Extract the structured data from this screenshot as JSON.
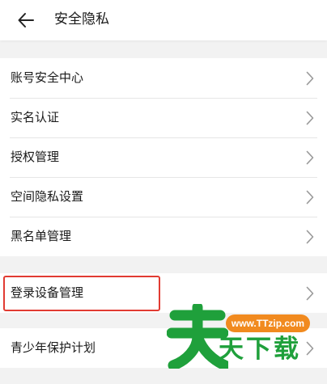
{
  "header": {
    "back_icon": "arrow-left-icon",
    "title": "安全隐私"
  },
  "groups": [
    {
      "items": [
        {
          "label": "账号安全中心"
        },
        {
          "label": "实名认证"
        },
        {
          "label": "授权管理"
        },
        {
          "label": "空间隐私设置"
        },
        {
          "label": "黑名单管理"
        }
      ]
    },
    {
      "items": [
        {
          "label": "登录设备管理",
          "highlighted": true
        }
      ]
    },
    {
      "items": [
        {
          "label": "青少年保护计划"
        }
      ]
    }
  ],
  "chevron_icon": "chevron-right-icon",
  "colors": {
    "background": "#f2f2f2",
    "highlight_border": "#e13b32",
    "watermark_green": "#1fa03b",
    "watermark_orange": "#f18a1f"
  },
  "watermark": {
    "glyph": "天",
    "url": "www.TTzip.com",
    "text": "天下载"
  }
}
